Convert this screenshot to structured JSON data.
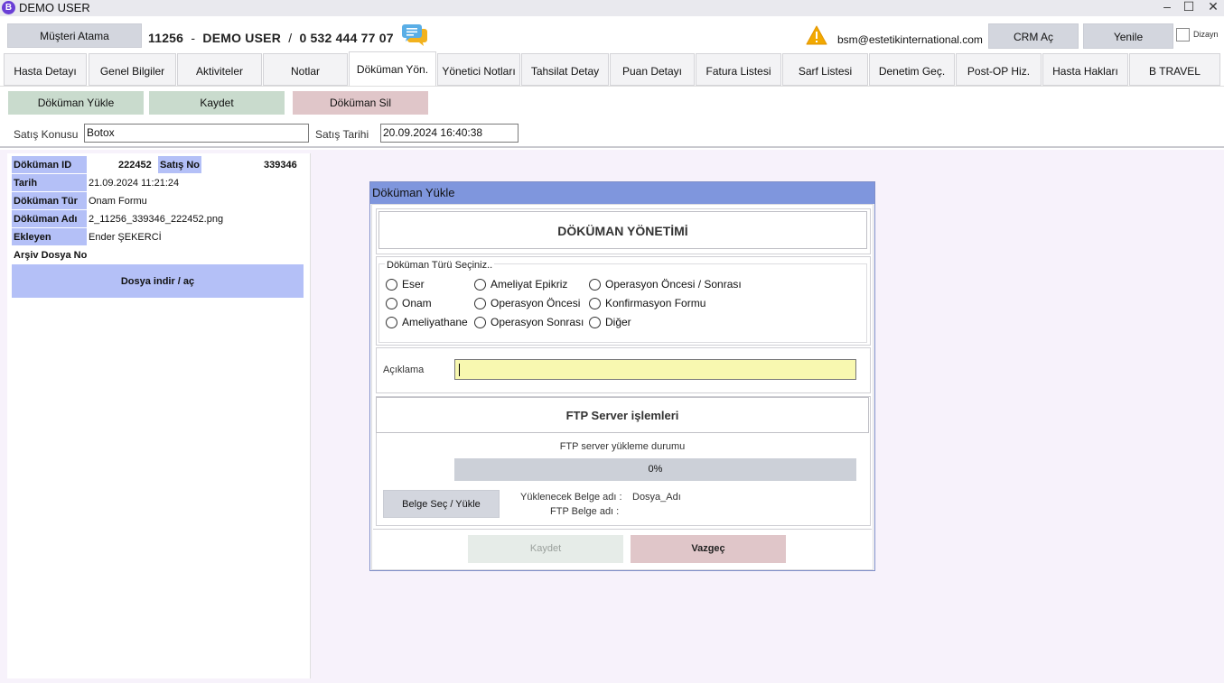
{
  "window": {
    "title": "DEMO USER",
    "icon_letter": "B",
    "minimize": "–",
    "maximize": "☐",
    "close": "✕"
  },
  "topbar": {
    "assign_customer_label": "Müşteri Atama",
    "patient_id": "11256",
    "separator1": "-",
    "patient_name": "DEMO USER",
    "separator2": "/",
    "phone": "0 532 444 77 07",
    "email": "bsm@estetikinternational.com",
    "crm_label": "CRM Aç",
    "refresh_label": "Yenile",
    "layout_label": "Dizayn"
  },
  "tabs": [
    {
      "label": "Hasta Detayı"
    },
    {
      "label": "Genel Bilgiler"
    },
    {
      "label": "Aktiviteler"
    },
    {
      "label": "Notlar"
    },
    {
      "label": "Döküman Yön."
    },
    {
      "label": "Yönetici Notları"
    },
    {
      "label": "Tahsilat Detay"
    },
    {
      "label": "Puan Detayı"
    },
    {
      "label": "Fatura Listesi"
    },
    {
      "label": "Sarf Listesi"
    },
    {
      "label": "Denetim Geç."
    },
    {
      "label": "Post-OP Hiz."
    },
    {
      "label": "Hasta Hakları"
    },
    {
      "label": "B TRAVEL"
    }
  ],
  "active_tab": "Döküman Yön.",
  "toolbar": {
    "upload_label": "Döküman Yükle",
    "save_label": "Kaydet",
    "delete_label": "Döküman Sil"
  },
  "sales": {
    "subject_label": "Satış Konusu",
    "subject_value": "Botox",
    "date_label": "Satış Tarihi",
    "date_value": "20.09.2024 16:40:38"
  },
  "document_info": {
    "id_label": "Döküman ID",
    "id_value": "222452",
    "sale_no_label": "Satış No",
    "sale_no_value": "339346",
    "date_label": "Tarih",
    "date_value": "21.09.2024 11:21:24",
    "type_label": "Döküman Tür",
    "type_value": "Onam Formu",
    "name_label": "Döküman Adı",
    "name_value": "2_11256_339346_222452.png",
    "added_by_label": "Ekleyen",
    "added_by_value": "Ender ŞEKERCİ",
    "archive_label": "Arşiv Dosya No",
    "archive_value": "",
    "download_label": "Dosya indir / aç"
  },
  "modal": {
    "title": "Döküman Yükle",
    "heading": "DÖKÜMAN YÖNETİMİ",
    "type_group_label": "Döküman Türü Seçiniz..",
    "types": [
      "Eser",
      "Onam",
      "Ameliyathane",
      "Ameliyat Epikriz",
      "Operasyon Öncesi",
      "Operasyon Sonrası",
      "Operasyon Öncesi / Sonrası",
      "Konfirmasyon Formu",
      "Diğer"
    ],
    "description_label": "Açıklama",
    "description_value": "",
    "ftp_heading": "FTP Server işlemleri",
    "ftp_status_label": "FTP server yükleme durumu",
    "progress_text": "0%",
    "progress_fraction": 0,
    "select_file_label": "Belge Seç / Yükle",
    "file_to_upload_label": "Yüklenecek Belge adı :",
    "file_to_upload_value": "Dosya_Adı",
    "ftp_file_label": "FTP  Belge adı :",
    "ftp_file_value": "",
    "save_label": "Kaydet",
    "cancel_label": "Vazgeç"
  },
  "colors": {
    "accent_blue": "#b4c0f7",
    "modal_title": "#7f96dd",
    "green_button": "#c9dbcd",
    "red_button": "#e0c6c9",
    "input_yellow": "#f8f8b0",
    "warning": "#f2a900"
  }
}
